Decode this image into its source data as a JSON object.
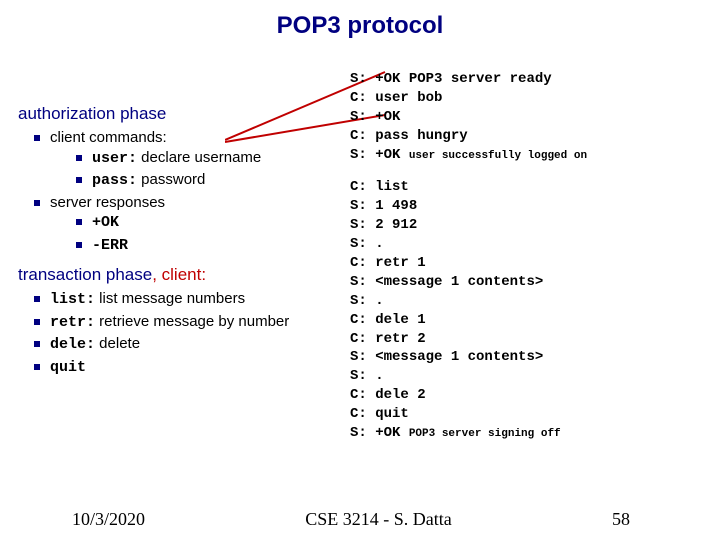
{
  "title": "POP3 protocol",
  "auth": {
    "heading": "authorization phase",
    "item1": "client commands:",
    "sub1a_cmd": "user:",
    "sub1a_txt": " declare username",
    "sub1b_cmd": "pass:",
    "sub1b_txt": " password",
    "item2": "server responses",
    "sub2a": "+OK",
    "sub2b": "-ERR"
  },
  "trans": {
    "heading_a": "transaction phase",
    "heading_b": ", client:",
    "li1_cmd": "list:",
    "li1_txt": " list message numbers",
    "li2_cmd": "retr:",
    "li2_txt": " retrieve message by number",
    "li3_cmd": "dele:",
    "li3_txt": " delete",
    "li4_cmd": "quit"
  },
  "proto_block1": [
    {
      "p": "S:",
      "t": " +OK POP3 server ready"
    },
    {
      "p": "C:",
      "t": " user bob"
    },
    {
      "p": "S:",
      "t": " +OK"
    },
    {
      "p": "C:",
      "t": " pass hungry"
    },
    {
      "p": "S:",
      "t": " +OK ",
      "s": "user successfully logged on"
    }
  ],
  "proto_block2": [
    {
      "p": "C:",
      "t": " list"
    },
    {
      "p": "S:",
      "t": " 1 498"
    },
    {
      "p": "S:",
      "t": " 2 912"
    },
    {
      "p": "S:",
      "t": " ."
    },
    {
      "p": "C:",
      "t": " retr 1"
    },
    {
      "p": "S:",
      "t": " <message 1 contents>"
    },
    {
      "p": "S:",
      "t": " ."
    },
    {
      "p": "C:",
      "t": " dele 1"
    },
    {
      "p": "C:",
      "t": " retr 2"
    },
    {
      "p": "S:",
      "t": " <message 1 contents>"
    },
    {
      "p": "S:",
      "t": " ."
    },
    {
      "p": "C:",
      "t": " dele 2"
    },
    {
      "p": "C:",
      "t": " quit"
    },
    {
      "p": "S:",
      "t": " +OK ",
      "s": "POP3 server signing off"
    }
  ],
  "footer": {
    "date": "10/3/2020",
    "course": "CSE 3214 - S. Datta",
    "page": "58"
  }
}
